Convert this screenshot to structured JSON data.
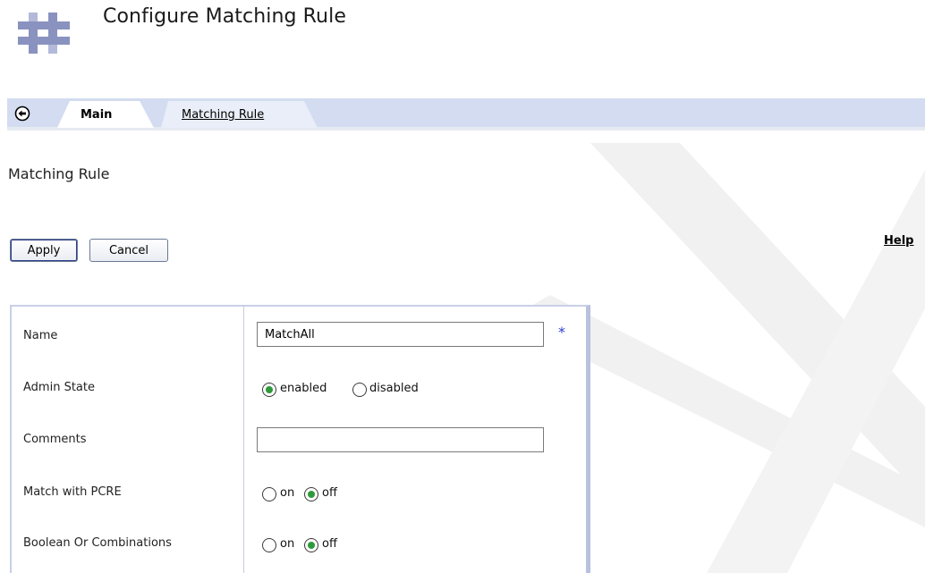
{
  "header": {
    "title": "Configure Matching Rule",
    "logo": "hash-logo-icon"
  },
  "tabs": {
    "back_icon": "back-arrow-icon",
    "items": [
      {
        "label": "Main",
        "active": true
      },
      {
        "label": "Matching Rule",
        "active": false
      }
    ]
  },
  "section": {
    "heading": "Matching Rule"
  },
  "actions": {
    "apply_label": "Apply",
    "cancel_label": "Cancel",
    "help_label": "Help"
  },
  "form": {
    "name": {
      "label": "Name",
      "value": "MatchAll",
      "required_marker": "*"
    },
    "admin_state": {
      "label": "Admin State",
      "options": [
        "enabled",
        "disabled"
      ],
      "selected": "enabled"
    },
    "comments": {
      "label": "Comments",
      "value": ""
    },
    "match_pcre": {
      "label": "Match with PCRE",
      "options": [
        "on",
        "off"
      ],
      "selected": "off"
    },
    "boolean_or": {
      "label": "Boolean Or Combinations",
      "options": [
        "on",
        "off"
      ],
      "selected": "off"
    }
  },
  "colors": {
    "tab_strip": "#d3dcf0",
    "radio_selected": "#2e9a3a",
    "required_star": "#2a3fd0",
    "logo": "#8a92bf"
  }
}
